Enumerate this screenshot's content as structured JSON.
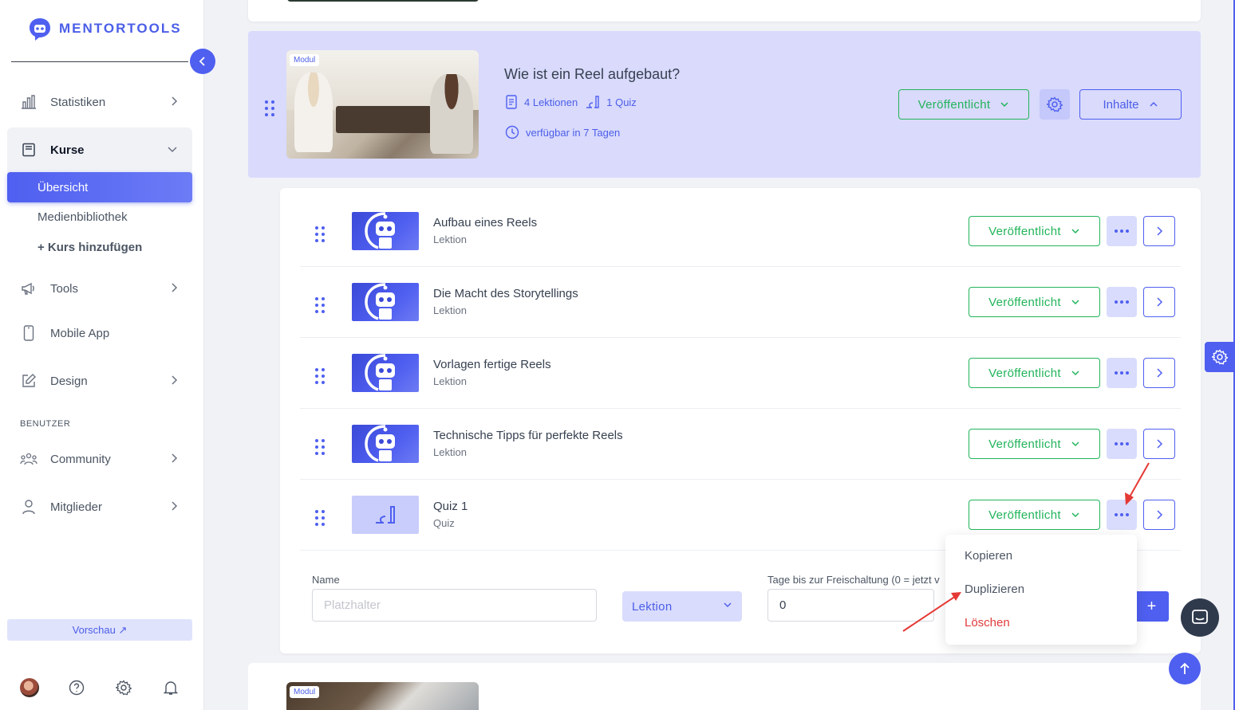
{
  "brand": {
    "name": "MENTORTOOLS",
    "accent": "#4f5ff0",
    "success": "#22b45a",
    "danger": "#e03b3b"
  },
  "sidebar": {
    "items": [
      {
        "label": "Statistiken",
        "icon": "bar-chart-icon"
      },
      {
        "label": "Kurse",
        "icon": "book-icon"
      },
      {
        "label": "Tools",
        "icon": "megaphone-icon"
      },
      {
        "label": "Mobile App",
        "icon": "phone-icon"
      },
      {
        "label": "Design",
        "icon": "edit-icon"
      },
      {
        "label": "Community",
        "icon": "users-icon"
      },
      {
        "label": "Mitglieder",
        "icon": "user-icon"
      }
    ],
    "sub_items": {
      "overview": "Übersicht",
      "media": "Medienbibliothek",
      "add_course": "+ Kurs hinzufügen"
    },
    "section_label": "BENUTZER",
    "preview_label": "Vorschau ↗"
  },
  "module": {
    "badge": "Modul",
    "title": "Wie ist ein Reel aufgebaut?",
    "lessons_count": "4 Lektionen",
    "quiz_count": "1 Quiz",
    "availability": "verfügbar in 7 Tagen",
    "status_label": "Veröffentlicht",
    "contents_label": "Inhalte"
  },
  "lessons": [
    {
      "title": "Aufbau eines Reels",
      "type": "Lektion",
      "status": "Veröffentlicht"
    },
    {
      "title": "Die Macht des Storytellings",
      "type": "Lektion",
      "status": "Veröffentlicht"
    },
    {
      "title": "Vorlagen fertige Reels",
      "type": "Lektion",
      "status": "Veröffentlicht"
    },
    {
      "title": "Technische Tipps für perfekte Reels",
      "type": "Lektion",
      "status": "Veröffentlicht"
    },
    {
      "title": "Quiz 1",
      "type": "Quiz",
      "status": "Veröffentlicht"
    }
  ],
  "form": {
    "name_label": "Name",
    "name_placeholder": "Platzhalter",
    "type_value": "Lektion",
    "days_label": "Tage bis zur Freischaltung (0 = jetzt v",
    "days_value": "0",
    "add_label": "+"
  },
  "dropdown": {
    "copy": "Kopieren",
    "duplicate": "Duplizieren",
    "delete": "Löschen"
  },
  "bottom_module": {
    "badge": "Modul"
  }
}
